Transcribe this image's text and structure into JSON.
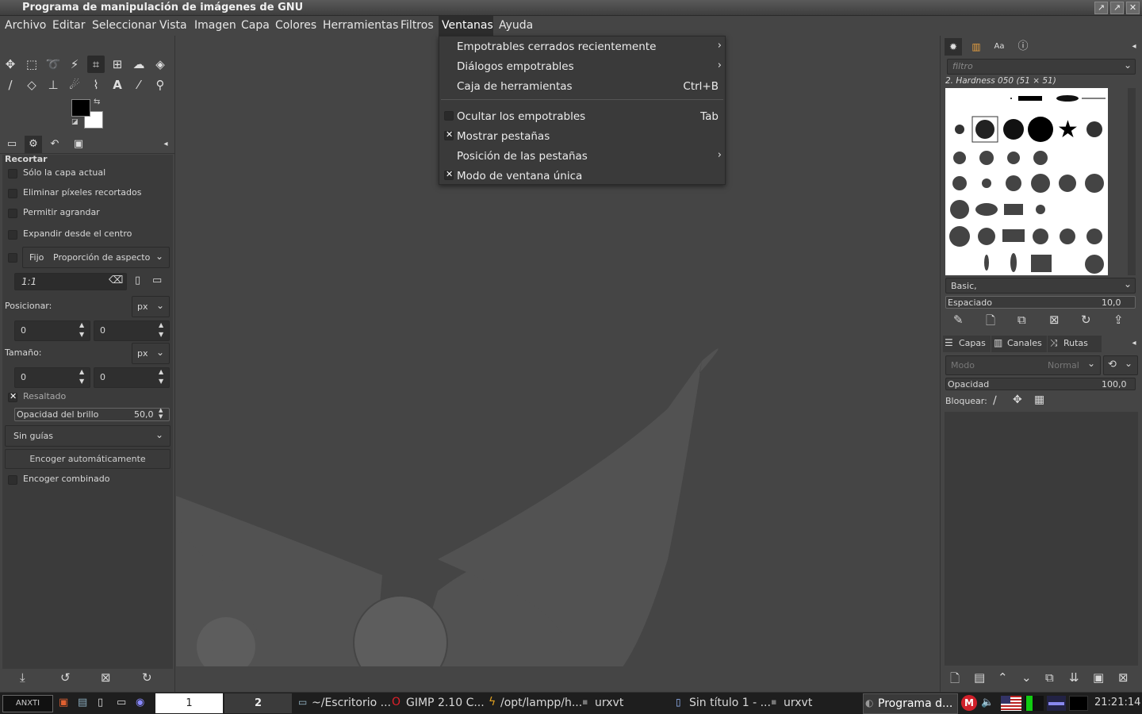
{
  "window": {
    "title": "Programa de manipulación de imágenes de GNU",
    "buttons": [
      "↗",
      "↗",
      "✕"
    ]
  },
  "menubar": [
    "Archivo",
    "Editar",
    "Seleccionar",
    "Vista",
    "Imagen",
    "Capa",
    "Colores",
    "Herramientas",
    "Filtros",
    "Ventanas",
    "Ayuda"
  ],
  "dropdown": {
    "items": [
      {
        "label": "Empotrables cerrados recientemente",
        "submenu": true
      },
      {
        "label": "Diálogos empotrables",
        "submenu": true
      },
      {
        "label": "Caja de herramientas",
        "shortcut": "Ctrl+B"
      },
      {
        "label": "Ocultar los empotrables",
        "shortcut": "Tab",
        "checked": false
      },
      {
        "label": "Mostrar pestañas",
        "checked": true
      },
      {
        "label": "Posición de las pestañas",
        "submenu": true
      },
      {
        "label": "Modo de ventana única",
        "checked": true
      }
    ]
  },
  "tool_options": {
    "title": "Recortar",
    "current_layer": "Sólo la capa actual",
    "delete_pixels": "Eliminar píxeles recortados",
    "allow_growing": "Permitir agrandar",
    "expand_center": "Expandir desde el centro",
    "fixed": "Fijo",
    "fixed_mode": "Proporción de aspecto",
    "ratio": "1:1",
    "position_label": "Posicionar:",
    "unit": "px",
    "pos_x": "0",
    "pos_y": "0",
    "size_label": "Tamaño:",
    "size_unit": "px",
    "size_w": "0",
    "size_h": "0",
    "highlight": "Resaltado",
    "highlight_opacity_label": "Opacidad del brillo",
    "highlight_opacity": "50,0",
    "guides": "Sin guías",
    "autoshrink": "Encoger automáticamente",
    "shrink_merged": "Encoger combinado"
  },
  "brushes": {
    "filter_placeholder": "filtro",
    "current": "2. Hardness 050 (51 × 51)",
    "tag": "Basic,",
    "spacing_label": "Espaciado",
    "spacing_value": "10,0"
  },
  "layers": {
    "tabs": [
      "Capas",
      "Canales",
      "Rutas"
    ],
    "mode_label": "Modo",
    "mode_value": "Normal",
    "opacity_label": "Opacidad",
    "opacity_value": "100,0",
    "lock_label": "Bloquear:"
  },
  "taskbar": {
    "workspace_1": "1",
    "workspace_2": "2",
    "tasks": [
      "~/Escritorio ...",
      "GIMP 2.10 C...",
      "/opt/lampp/h...",
      "urxvt",
      "Sin título 1 - ...",
      "urxvt",
      "Programa d..."
    ],
    "clock": "21:21:14"
  }
}
